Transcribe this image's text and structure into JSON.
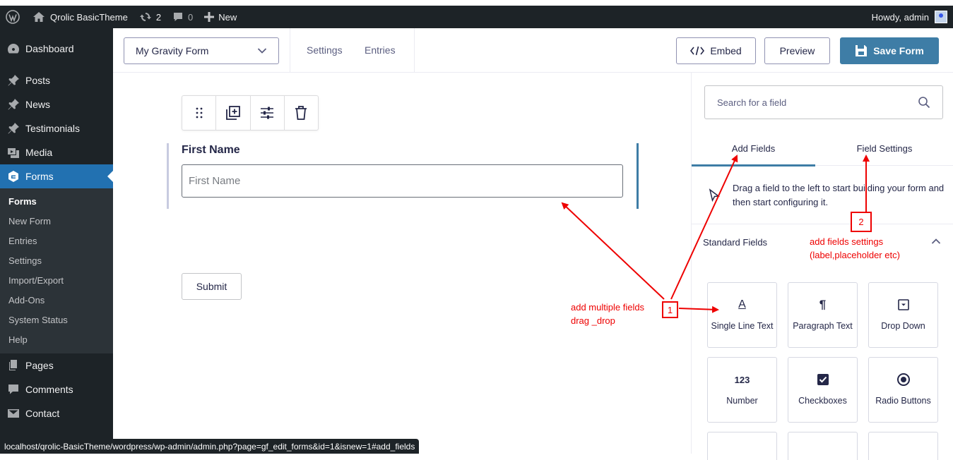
{
  "adminbar": {
    "site_name": "Qrolic BasicTheme",
    "updates_count": "2",
    "comments_count": "0",
    "new_label": "New",
    "howdy": "Howdy, admin"
  },
  "sidebar": {
    "items": [
      {
        "label": "Dashboard",
        "icon": "dashboard-icon"
      },
      {
        "label": "Posts",
        "icon": "pin-icon"
      },
      {
        "label": "News",
        "icon": "pin-icon"
      },
      {
        "label": "Testimonials",
        "icon": "pin-icon"
      },
      {
        "label": "Media",
        "icon": "media-icon"
      },
      {
        "label": "Forms",
        "icon": "gravity-forms-icon"
      },
      {
        "label": "Pages",
        "icon": "pages-icon"
      },
      {
        "label": "Comments",
        "icon": "comments-icon"
      },
      {
        "label": "Contact",
        "icon": "mail-icon"
      }
    ],
    "forms_submenu": [
      "Forms",
      "New Form",
      "Entries",
      "Settings",
      "Import/Export",
      "Add-Ons",
      "System Status",
      "Help"
    ]
  },
  "toolbar": {
    "form_name": "My Gravity Form",
    "settings_label": "Settings",
    "entries_label": "Entries",
    "embed_label": "Embed",
    "preview_label": "Preview",
    "save_label": "Save Form"
  },
  "editor": {
    "field_label": "First Name",
    "field_placeholder": "First Name",
    "submit_label": "Submit"
  },
  "panel": {
    "search_placeholder": "Search for a field",
    "tab_add": "Add Fields",
    "tab_settings": "Field Settings",
    "hint": "Drag a field to the left to start building your form and then start configuring it.",
    "section_title": "Standard Fields",
    "fields": [
      {
        "label": "Single Line Text",
        "icon": "text-icon",
        "glyph": "A"
      },
      {
        "label": "Paragraph Text",
        "icon": "paragraph-icon",
        "glyph": "¶"
      },
      {
        "label": "Drop Down",
        "icon": "dropdown-icon",
        "glyph": ""
      },
      {
        "label": "Number",
        "icon": "number-icon",
        "glyph": "123"
      },
      {
        "label": "Checkboxes",
        "icon": "checkbox-icon",
        "glyph": ""
      },
      {
        "label": "Radio Buttons",
        "icon": "radio-icon",
        "glyph": ""
      }
    ]
  },
  "statusbar": {
    "url": "localhost/qrolic-BasicTheme/wordpress/wp-admin/admin.php?page=gf_edit_forms&id=1&isnew=1#add_fields"
  },
  "annotations": {
    "box1": "1",
    "box2": "2",
    "note1_line1": "add multiple fields",
    "note1_line2": "drag _drop",
    "note2_line1": "add fields settings",
    "note2_line2": "(label,placeholder etc)"
  }
}
